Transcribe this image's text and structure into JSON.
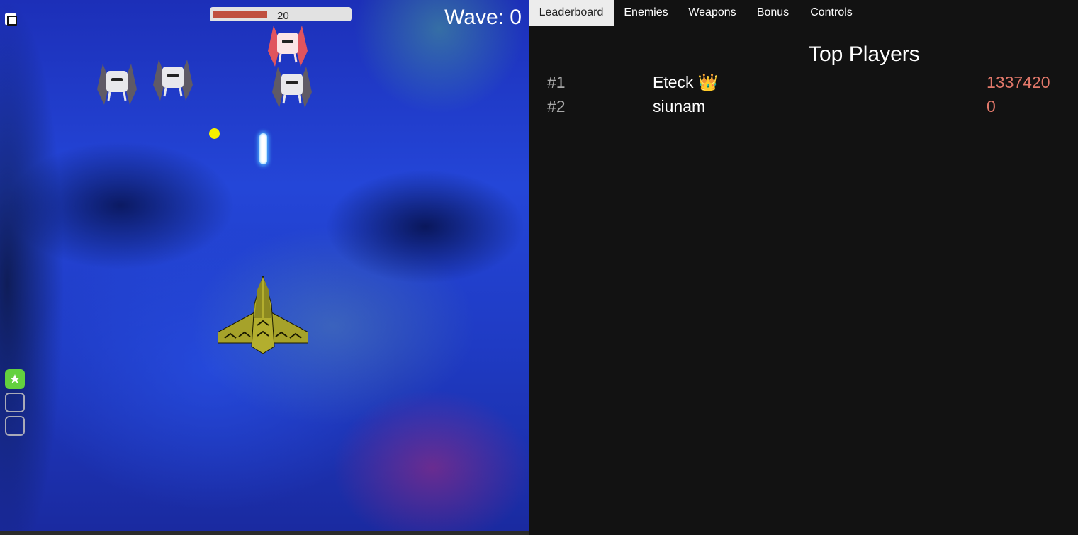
{
  "hud": {
    "health_value": "20",
    "health_fraction": 0.4,
    "wave_text": "Wave: 0"
  },
  "tabs": [
    "Leaderboard",
    "Enemies",
    "Weapons",
    "Bonus",
    "Controls"
  ],
  "active_tab": "Leaderboard",
  "leaderboard": {
    "title": "Top Players",
    "players": [
      {
        "rank": "#1",
        "name": "Eteck",
        "badge": "👑",
        "score": "1337420"
      },
      {
        "rank": "#2",
        "name": "siunam",
        "badge": "",
        "score": "0"
      }
    ]
  },
  "icons": {
    "fullscreen": "fullscreen-icon",
    "powerup": "star-icon",
    "enemy": "enemy-fighter-icon",
    "boss_enemy": "enemy-fighter-red-icon",
    "player": "player-ship-icon"
  },
  "colors": {
    "health_fill": "#c0503f",
    "score": "#e2786a",
    "active_slot": "#63d13e"
  }
}
